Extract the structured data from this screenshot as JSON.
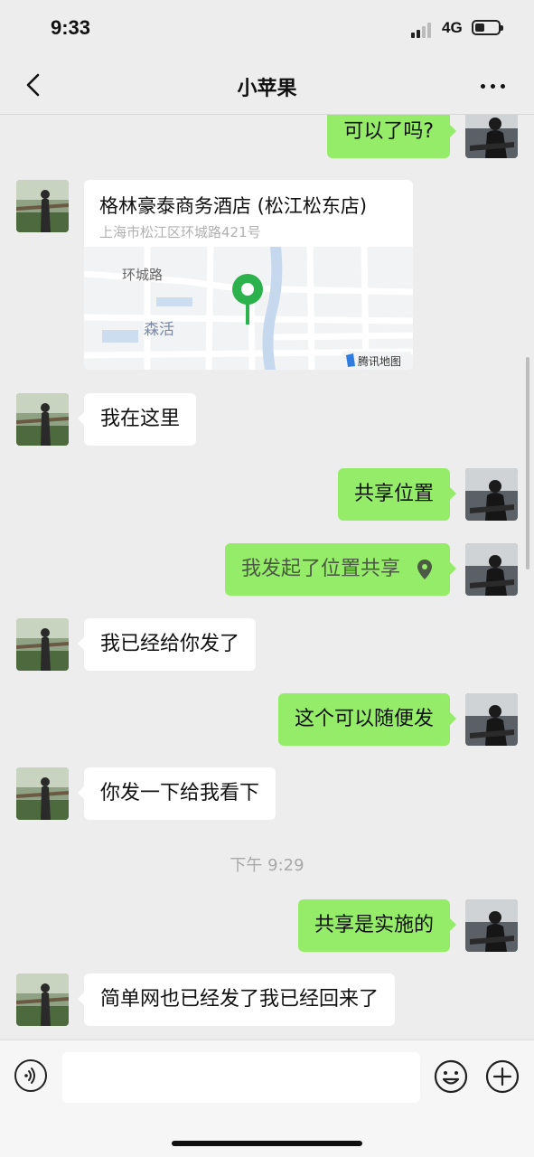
{
  "status": {
    "time": "9:33",
    "network": "4G"
  },
  "header": {
    "title": "小苹果"
  },
  "messages": {
    "m1": "可以了吗?",
    "location": {
      "name": "格林豪泰商务酒店 (松江松东店)",
      "address": "上海市松江区环城路421号",
      "map_label_road": "环城路",
      "map_label_area": "森活",
      "map_brand": "腾讯地图"
    },
    "m2": "我在这里",
    "m3": "共享位置",
    "m4": "我发起了位置共享",
    "m5": "我已经给你发了",
    "m6": "这个可以随便发",
    "m7": "你发一下给我看下",
    "timestamp": "下午 9:29",
    "m8": "共享是实施的",
    "m9": "简单网也已经发了我已经回来了"
  },
  "input": {
    "value": ""
  },
  "colors": {
    "background": "#ededed",
    "sent_bubble": "#95ec69",
    "received_bubble": "#ffffff",
    "map_pin": "#2bb24c"
  },
  "icons": {
    "back": "chevron-left-icon",
    "more": "more-dots-icon",
    "voice": "voice-icon",
    "emoji": "emoji-icon",
    "plus": "plus-icon",
    "pin": "location-pin-icon"
  }
}
